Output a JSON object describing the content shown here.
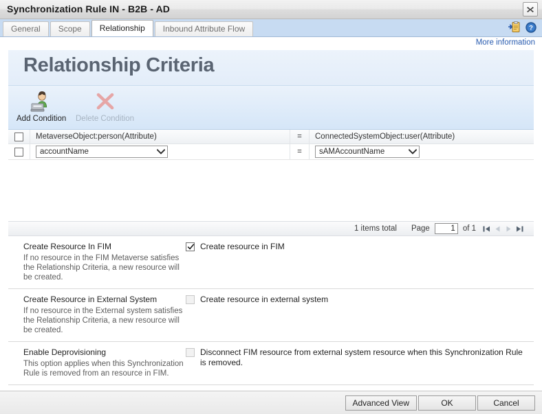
{
  "window": {
    "title": "Synchronization Rule IN - B2B - AD",
    "close_label": "×"
  },
  "tabs": [
    {
      "label": "General",
      "active": false
    },
    {
      "label": "Scope",
      "active": false
    },
    {
      "label": "Relationship",
      "active": true
    },
    {
      "label": "Inbound Attribute Flow",
      "active": false
    }
  ],
  "tab_icons": {
    "clipboard": "clipboard-icon",
    "help": "help-icon"
  },
  "links": {
    "more_information": "More information"
  },
  "panel": {
    "title": "Relationship Criteria"
  },
  "toolbar": {
    "add_condition": "Add Condition",
    "delete_condition": "Delete Condition",
    "delete_disabled": true
  },
  "grid": {
    "header": {
      "checkbox": "",
      "left": "MetaverseObject:person(Attribute)",
      "operator": "=",
      "right": "ConnectedSystemObject:user(Attribute)"
    },
    "rows": [
      {
        "checked": false,
        "left_value": "accountName",
        "operator": "=",
        "right_value": "sAMAccountName"
      }
    ]
  },
  "pager": {
    "items_total": "1 items total",
    "page_label": "Page",
    "page_value": "1",
    "of_label": "of 1",
    "first": "first-page-button",
    "prev": "previous-page-button",
    "next": "next-page-button",
    "last": "last-page-button"
  },
  "sections": [
    {
      "title": "Create Resource In FIM",
      "description": "If no resource in the FIM Metaverse satisfies the Relationship Criteria, a new resource will be created.",
      "checkbox_label": "Create resource in FIM",
      "checked": true,
      "disabled": false
    },
    {
      "title": "Create Resource in External System",
      "description": "If no resource in the External system satisfies the Relationship Criteria, a new resource will be created.",
      "checkbox_label": "Create resource in external system",
      "checked": false,
      "disabled": true
    },
    {
      "title": "Enable Deprovisioning",
      "description": "This option applies when this Synchronization Rule is removed from an resource in FIM.",
      "checkbox_label": "Disconnect FIM resource from external system resource when this Synchronization Rule is removed.",
      "checked": false,
      "disabled": true
    }
  ],
  "footer": {
    "advanced_view": "Advanced View",
    "ok": "OK",
    "cancel": "Cancel"
  },
  "colors": {
    "tabstrip": "#c7dbf2",
    "panel_header": "#e8f0fa",
    "toolbar": "#d9e8f8",
    "link": "#2a5db0",
    "title_text": "#5a6472"
  }
}
